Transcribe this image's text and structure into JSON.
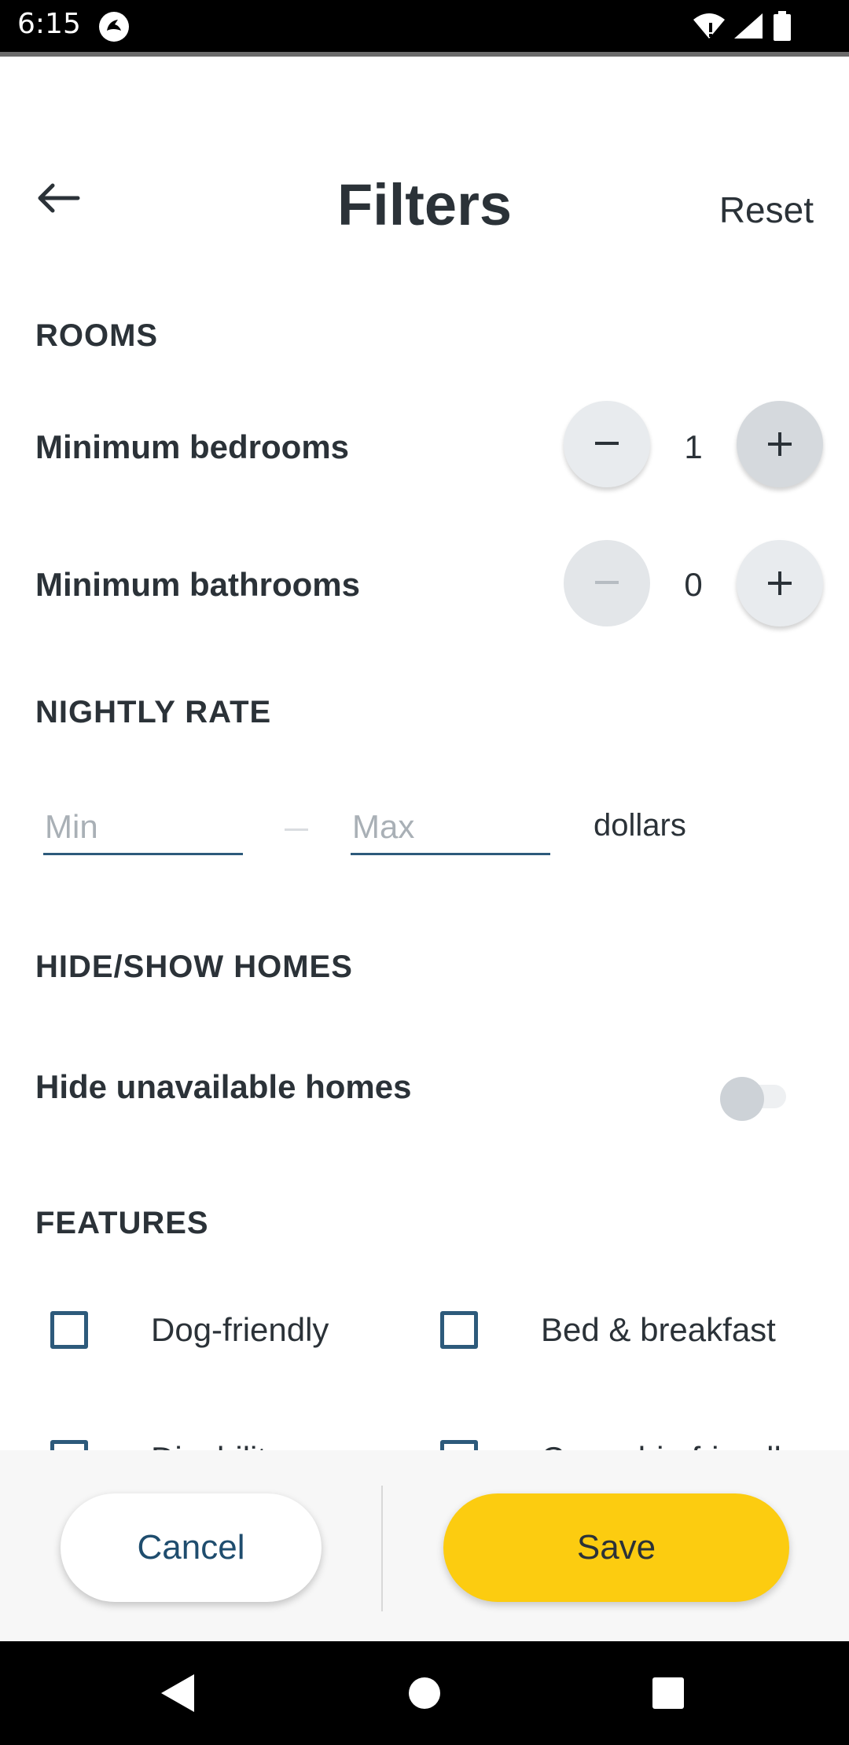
{
  "status_bar": {
    "time": "6:15"
  },
  "header": {
    "title": "Filters",
    "reset_label": "Reset"
  },
  "rooms": {
    "heading": "ROOMS",
    "bedrooms": {
      "label": "Minimum bedrooms",
      "value": "1"
    },
    "bathrooms": {
      "label": "Minimum bathrooms",
      "value": "0"
    }
  },
  "nightly_rate": {
    "heading": "NIGHTLY RATE",
    "min_placeholder": "Min",
    "max_placeholder": "Max",
    "min_value": "",
    "max_value": "",
    "unit": "dollars"
  },
  "hide_show": {
    "heading": "HIDE/SHOW HOMES",
    "hide_unavailable_label": "Hide unavailable homes",
    "hide_unavailable_on": false
  },
  "features": {
    "heading": "FEATURES",
    "items": [
      {
        "label": "Dog-friendly",
        "checked": false
      },
      {
        "label": "Bed & breakfast",
        "checked": false
      },
      {
        "label": "Disability access",
        "checked": false
      },
      {
        "label": "Cannabis-friendly",
        "checked": false
      }
    ]
  },
  "footer": {
    "cancel_label": "Cancel",
    "save_label": "Save"
  },
  "colors": {
    "accent": "#fccc10",
    "primary": "#2d5a7b",
    "text": "#2b3238"
  }
}
